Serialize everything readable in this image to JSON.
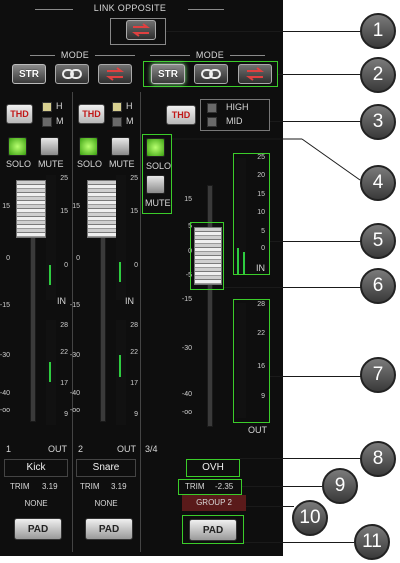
{
  "link_opposite_label": "LINK OPPOSITE",
  "mode_label": "MODE",
  "buttons": {
    "str": "STR",
    "thd": "THD",
    "solo": "SOLO",
    "mute": "MUTE",
    "pad": "PAD"
  },
  "mid_modes": {
    "h": "H",
    "m": "M",
    "high": "HIGH",
    "mid": "MID"
  },
  "meter_labels": {
    "in": "IN",
    "out": "OUT"
  },
  "fader_scale": [
    "15",
    "5",
    "0",
    "-5",
    "-15",
    "-30",
    "-40",
    "-oo"
  ],
  "meter_scale_in": [
    "25",
    "15",
    "0"
  ],
  "meter_scale_out": [
    "28",
    "22",
    "17",
    "9"
  ],
  "wide_in_scale": [
    "25",
    "20",
    "15",
    "10",
    "5",
    "0"
  ],
  "wide_out_scale": [
    "28",
    "22",
    "16",
    "9"
  ],
  "channels": [
    {
      "number": "1",
      "name": "Kick",
      "trim_label": "TRIM",
      "trim_value": "3.19",
      "group": "NONE"
    },
    {
      "number": "2",
      "name": "Snare",
      "trim_label": "TRIM",
      "trim_value": "3.19",
      "group": "NONE"
    },
    {
      "number": "3/4",
      "name": "OVH",
      "trim_label": "TRIM",
      "trim_value": "-2.35",
      "group": "GROUP 2"
    }
  ],
  "callouts": [
    "1",
    "2",
    "3",
    "4",
    "5",
    "6",
    "7",
    "8",
    "9",
    "10",
    "11"
  ],
  "colors": {
    "highlight": "#3bcc2a",
    "panel": "#0e0e0e",
    "thd_red": "#c01818",
    "group_active": "#5a1a1a"
  }
}
